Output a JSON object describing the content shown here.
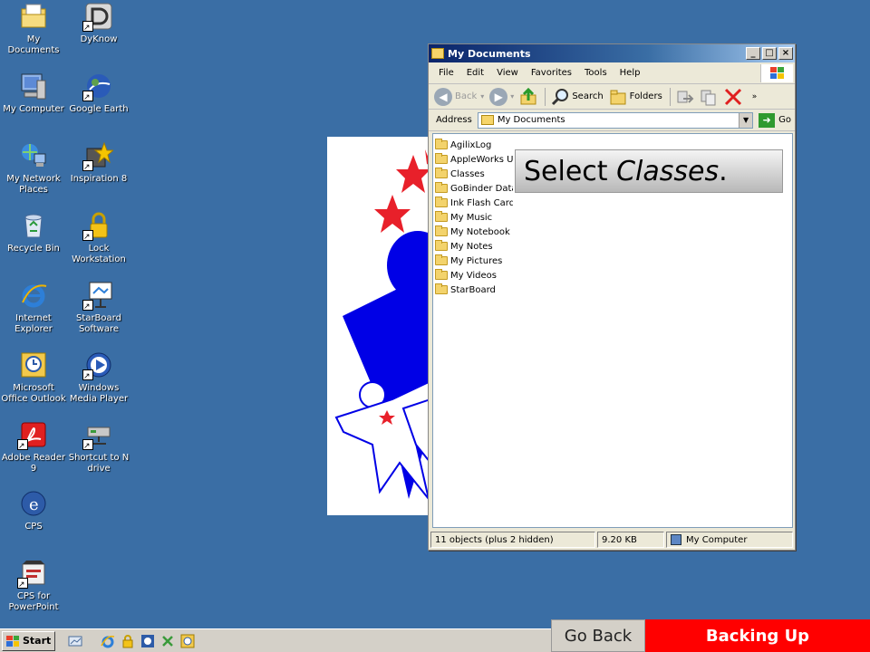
{
  "desktop": {
    "icons": [
      {
        "label": "My Documents",
        "icon": "my-documents-icon"
      },
      {
        "label": "DyKnow",
        "icon": "dyknow-icon"
      },
      {
        "label": "My Computer",
        "icon": "my-computer-icon"
      },
      {
        "label": "Google Earth",
        "icon": "google-earth-icon"
      },
      {
        "label": "My Network Places",
        "icon": "network-places-icon"
      },
      {
        "label": "Inspiration 8",
        "icon": "inspiration-icon"
      },
      {
        "label": "Recycle Bin",
        "icon": "recycle-bin-icon"
      },
      {
        "label": "Lock Workstation",
        "icon": "lock-icon"
      },
      {
        "label": "Internet Explorer",
        "icon": "internet-explorer-icon"
      },
      {
        "label": "StarBoard Software",
        "icon": "starboard-icon"
      },
      {
        "label": "Microsoft Office Outlook",
        "icon": "outlook-icon"
      },
      {
        "label": "Windows Media Player",
        "icon": "media-player-icon"
      },
      {
        "label": "Adobe Reader 9",
        "icon": "adobe-reader-icon"
      },
      {
        "label": "Shortcut to N drive",
        "icon": "network-drive-icon"
      },
      {
        "label": "CPS",
        "icon": "cps-icon"
      },
      {
        "label": "CPS for PowerPoint",
        "icon": "cps-powerpoint-icon"
      }
    ]
  },
  "window": {
    "title": "My Documents",
    "menu": [
      "File",
      "Edit",
      "View",
      "Favorites",
      "Tools",
      "Help"
    ],
    "toolbar": {
      "back": "Back",
      "search": "Search",
      "folders": "Folders"
    },
    "address": {
      "label": "Address",
      "value": "My Documents",
      "go": "Go"
    },
    "files": [
      "AgilixLog",
      "AppleWorks User Data",
      "Classes",
      "GoBinder Database",
      "Ink Flash Cards",
      "My Music",
      "My Notebook",
      "My Notes",
      "My Pictures",
      "My Videos",
      "StarBoard"
    ],
    "status": {
      "objects": "11 objects (plus 2 hidden)",
      "size": "9.20 KB",
      "location": "My Computer"
    }
  },
  "callout": {
    "prefix": "Select ",
    "emphasis": "Classes",
    "suffix": "."
  },
  "taskbar": {
    "start": "Start"
  },
  "nav": {
    "go_back": "Go Back",
    "section": "Backing Up"
  },
  "colors": {
    "desktop": "#3a6ea5",
    "accent_red": "#ff0000",
    "art_blue": "#0000e6"
  }
}
